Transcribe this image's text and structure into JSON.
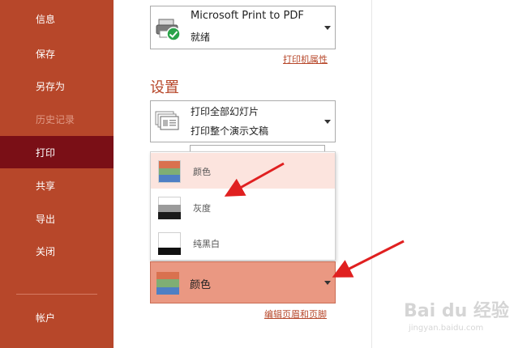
{
  "sidebar": {
    "items": [
      {
        "label": "信息"
      },
      {
        "label": "保存"
      },
      {
        "label": "另存为"
      },
      {
        "label": "历史记录"
      },
      {
        "label": "打印"
      },
      {
        "label": "共享"
      },
      {
        "label": "导出"
      },
      {
        "label": "关闭"
      },
      {
        "label": "帐户"
      }
    ]
  },
  "printer": {
    "name": "Microsoft Print to PDF",
    "status": "就绪",
    "properties_link": "打印机属性"
  },
  "settings": {
    "title": "设置",
    "slides_option_line1": "打印全部幻灯片",
    "slides_option_line2": "打印整个演示文稿"
  },
  "color_dropdown": {
    "options": [
      {
        "label": "颜色"
      },
      {
        "label": "灰度"
      },
      {
        "label": "纯黑白"
      }
    ],
    "current": "颜色"
  },
  "footer_link": "编辑页眉和页脚",
  "watermark": {
    "brand": "Bai du 经验",
    "url": "jingyan.baidu.com"
  },
  "colors": {
    "sidebar": "#b7472a",
    "sidebar_active": "#7a0f16",
    "accent": "#b7472a",
    "selected_option": "#fce4de",
    "color_selector": "#ea9882",
    "arrow": "#e02020"
  },
  "icons": [
    "printer-icon",
    "checkmark-icon",
    "slides-icon",
    "color-swatch-icon",
    "grayscale-swatch-icon",
    "bw-swatch-icon",
    "chevron-down-icon"
  ]
}
